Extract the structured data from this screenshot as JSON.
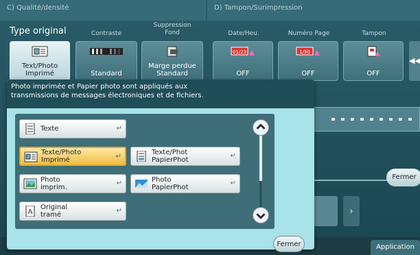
{
  "sections": {
    "c": "C) Qualité/densité",
    "d": "D) Tampon/Surimpression"
  },
  "settings": [
    {
      "caption": "Type original",
      "value": "Text/Photo\nImprimé",
      "active": true
    },
    {
      "caption": "Contraste",
      "value": "Standard"
    },
    {
      "caption": "Suppression\nFond",
      "value": "Marge perdue\nStandard"
    },
    {
      "caption": "Date/Heu.",
      "value": "OFF"
    },
    {
      "caption": "Numéro Page",
      "value": "OFF"
    },
    {
      "caption": "Tampon",
      "value": "OFF"
    }
  ],
  "tile_badges": {
    "date": "01/23",
    "page": "1/50"
  },
  "background_fermer": "Fermer",
  "application_tab": "Application",
  "popup": {
    "message": "Photo imprimée et Papier photo sont appliqués aux\ntransmissions de messages électroniques et de fichiers.",
    "options": [
      {
        "label": "Texte",
        "icon": "text-doc-icon"
      },
      {
        "label": "Texte/Photo\nImprimé",
        "icon": "text-photo-printed-icon",
        "selected": true
      },
      {
        "label": "Texte/Phot\nPapierPhot",
        "icon": "text-photo-paper-icon"
      },
      {
        "label": "Photo\nimprim.",
        "icon": "photo-printed-icon"
      },
      {
        "label": "Photo\nPapierPhot",
        "icon": "photo-paper-icon"
      },
      {
        "label": "Original\ntramé",
        "icon": "dot-matrix-original-icon"
      }
    ],
    "enter_glyph": "↵",
    "scroll_up": "⌃",
    "scroll_down": "⌄",
    "close_label": "Fermer"
  },
  "colors": {
    "accent_selected": "#f0bd44",
    "popup_bg": "#a7e3e8",
    "panel_bg": "#3e6e78"
  }
}
